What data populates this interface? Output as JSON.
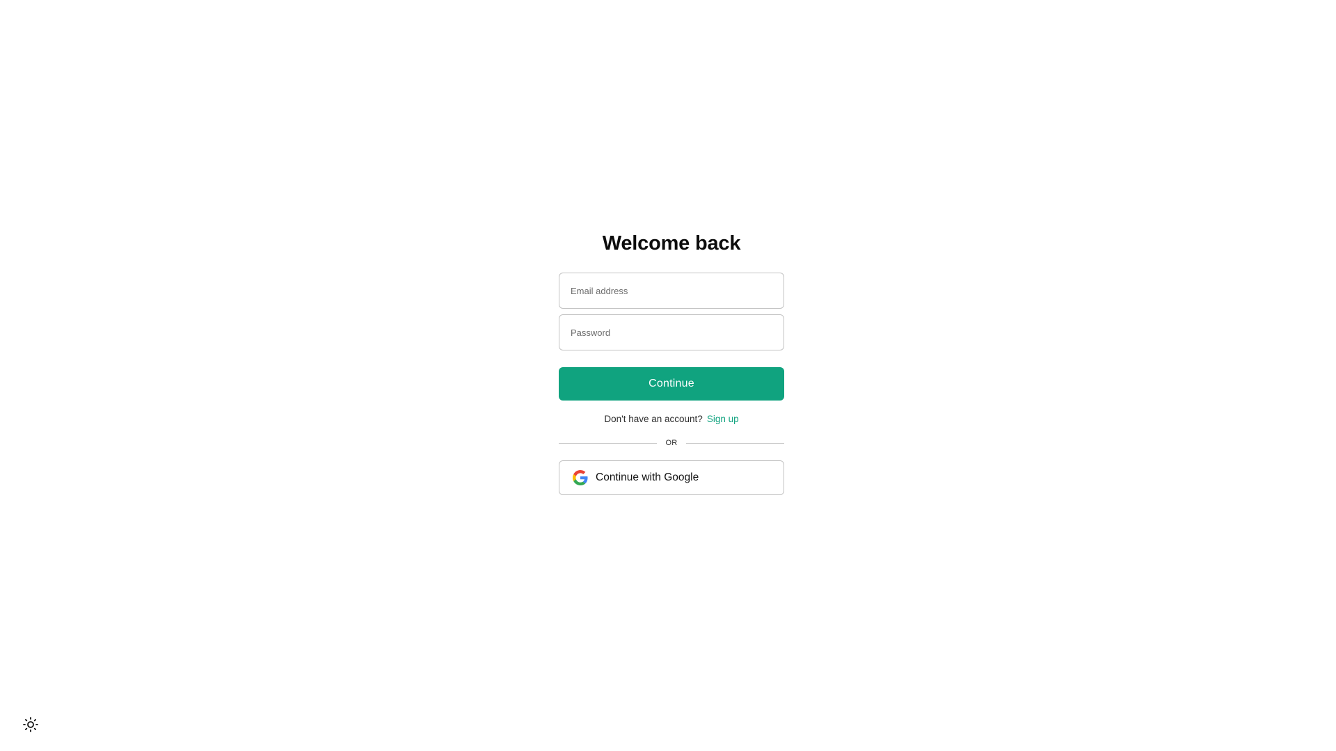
{
  "login": {
    "title": "Welcome back",
    "email_placeholder": "Email address",
    "password_placeholder": "Password",
    "continue_label": "Continue",
    "signup_prompt": "Don't have an account?",
    "signup_link": "Sign up",
    "divider_text": "OR",
    "google_label": "Continue with Google"
  },
  "colors": {
    "accent": "#10a37f",
    "border": "#c2c2c2",
    "background": "#ffffff"
  },
  "icons": {
    "google": "google-logo-icon",
    "theme": "sun-icon"
  }
}
